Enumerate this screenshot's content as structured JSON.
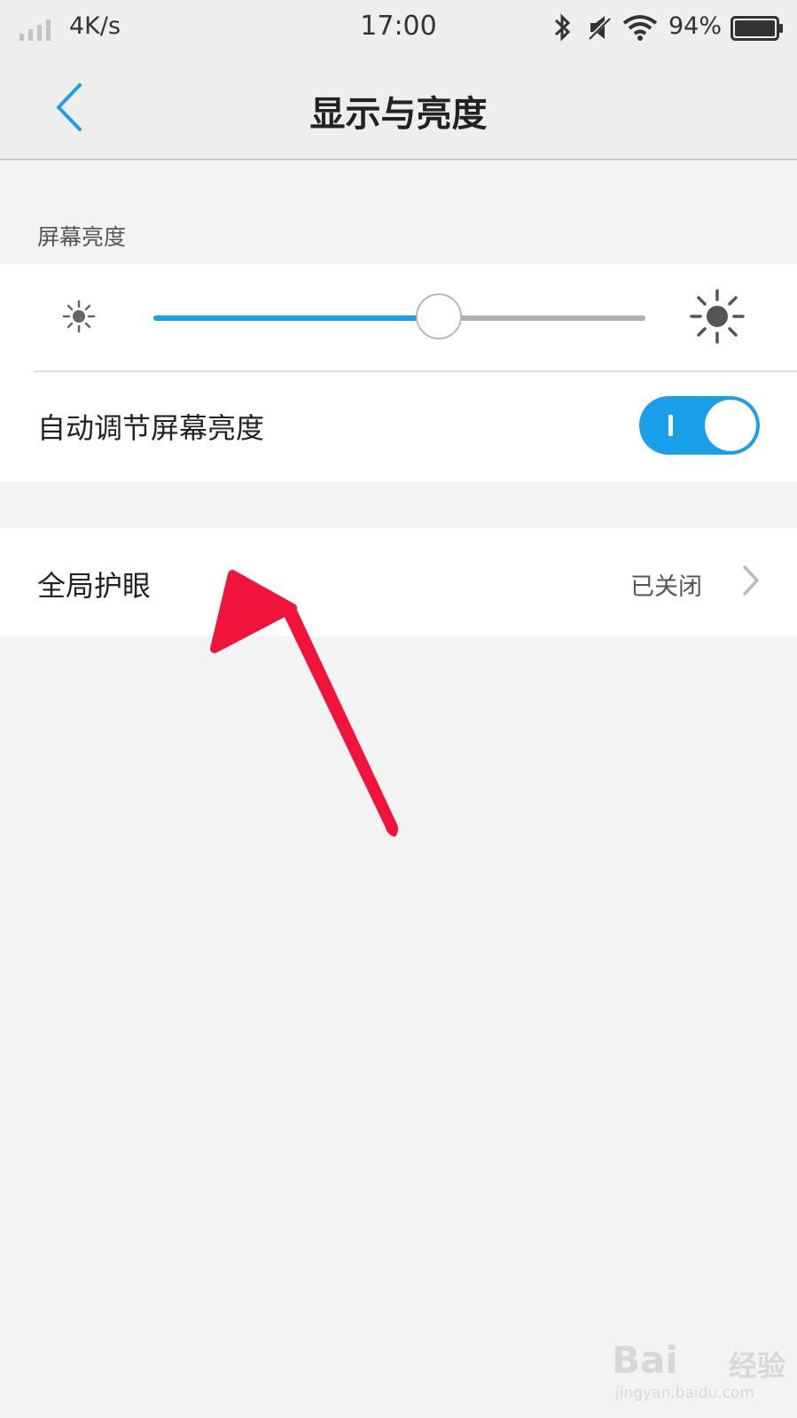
{
  "status_bar": {
    "net_speed": "4K/s",
    "time": "17:00",
    "battery_percent": "94%",
    "icons": [
      "signal-icon",
      "bluetooth-icon",
      "mute-icon",
      "wifi-icon",
      "battery-icon"
    ]
  },
  "nav": {
    "back_icon": "chevron-left-icon",
    "title": "显示与亮度"
  },
  "brightness_section": {
    "label": "屏幕亮度",
    "slider_value_fraction": 0.58,
    "icons": [
      "sun-small-icon",
      "sun-large-icon"
    ],
    "auto_label": "自动调节屏幕亮度",
    "auto_enabled": true
  },
  "eye_care": {
    "label": "全局护眼",
    "value": "已关闭",
    "icon": "chevron-right-icon"
  },
  "colors": {
    "accent": "#1aa0ea",
    "annotation_arrow": "#f0143c",
    "background": "#f3f3f3"
  },
  "watermark": {
    "brand": "Bai",
    "brand_cn": "经验",
    "url": "jingyan.baidu.com"
  }
}
